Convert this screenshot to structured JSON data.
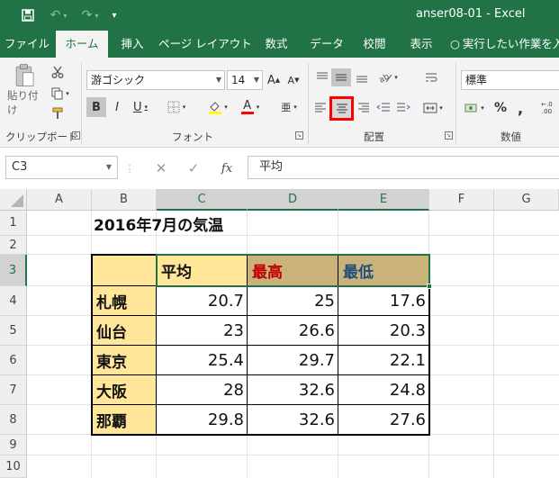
{
  "title_bar": {
    "doc_title": "anser08-01  -  Excel",
    "save_icon": "save-icon",
    "undo_icon": "undo-icon",
    "redo_icon": "redo-icon",
    "customize_icon": "customize-qat-icon"
  },
  "tabs": [
    "ファイル",
    "ホーム",
    "挿入",
    "ページ レイアウト",
    "数式",
    "データ",
    "校閲",
    "表示",
    "実行したい作業を入"
  ],
  "active_tab": "ホーム",
  "ribbon": {
    "clipboard": {
      "paste_label": "貼り付け",
      "group_label": "クリップボード"
    },
    "font": {
      "font_name": "游ゴシック",
      "font_size": "14",
      "bold": "B",
      "italic": "I",
      "underline": "U",
      "grow": "A",
      "shrink": "A",
      "font_color_letter": "A",
      "phonetic": "亜",
      "group_label": "フォント"
    },
    "alignment": {
      "group_label": "配置",
      "center_highlighted": true
    },
    "number": {
      "format": "標準",
      "percent": "%",
      "comma": ",",
      "group_label": "数値"
    }
  },
  "formula_bar": {
    "name_box": "C3",
    "fx": "fx",
    "content": "平均"
  },
  "columns": [
    "A",
    "B",
    "C",
    "D",
    "E",
    "F",
    "G"
  ],
  "rows": [
    "1",
    "2",
    "3",
    "4",
    "5",
    "6",
    "7",
    "8",
    "9",
    "10"
  ],
  "sheet": {
    "title": "2016年7月の気温",
    "headers": [
      "平均",
      "最高",
      "最低"
    ],
    "header_colors": [
      "#111111",
      "#c00000",
      "#1f4e79"
    ],
    "cities": [
      "札幌",
      "仙台",
      "東京",
      "大阪",
      "那覇"
    ],
    "values": [
      [
        "20.7",
        "25",
        "17.6"
      ],
      [
        "23",
        "26.6",
        "20.3"
      ],
      [
        "25.4",
        "29.7",
        "22.1"
      ],
      [
        "28",
        "32.6",
        "24.8"
      ],
      [
        "29.8",
        "32.6",
        "27.6"
      ]
    ]
  },
  "colors": {
    "excel_green": "#217346",
    "city_fill": "#ffe699",
    "header_fill_c": "#ffe699",
    "header_fill_de": "#c9b37a",
    "highlight_red": "#ff0000"
  }
}
